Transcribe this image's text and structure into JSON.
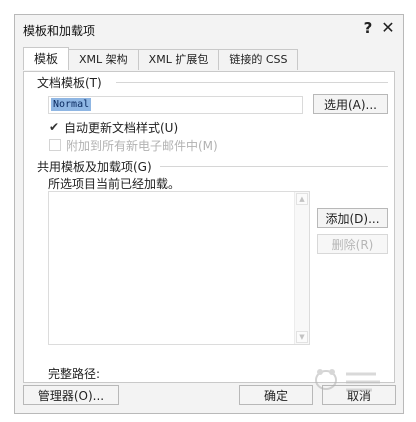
{
  "window": {
    "title": "模板和加载项",
    "help_label": "?",
    "close_label": "✕"
  },
  "tabs": [
    {
      "label": "模板",
      "active": true
    },
    {
      "label": "XML 架构",
      "active": false
    },
    {
      "label": "XML 扩展包",
      "active": false
    },
    {
      "label": "链接的 CSS",
      "active": false
    }
  ],
  "document_template": {
    "group_label": "文档模板(T)",
    "value": "Normal",
    "attach_button": "选用(A)...",
    "auto_update_label": "自动更新文档样式(U)",
    "auto_update_checked": true,
    "attach_email_label": "附加到所有新电子邮件中(M)",
    "attach_email_checked": false
  },
  "global_templates": {
    "group_label": "共用模板及加载项(G)",
    "status_text": "所选项目当前已经加载。",
    "add_button": "添加(D)...",
    "remove_button": "删除(R)",
    "items": []
  },
  "path": {
    "label": "完整路径:"
  },
  "footer": {
    "organizer_button": "管理器(O)...",
    "ok_button": "确定",
    "cancel_button": "取消"
  },
  "icons": {
    "checkmark": "check-icon",
    "scroll_up": "scroll-up-icon",
    "scroll_down": "scroll-down-icon"
  }
}
